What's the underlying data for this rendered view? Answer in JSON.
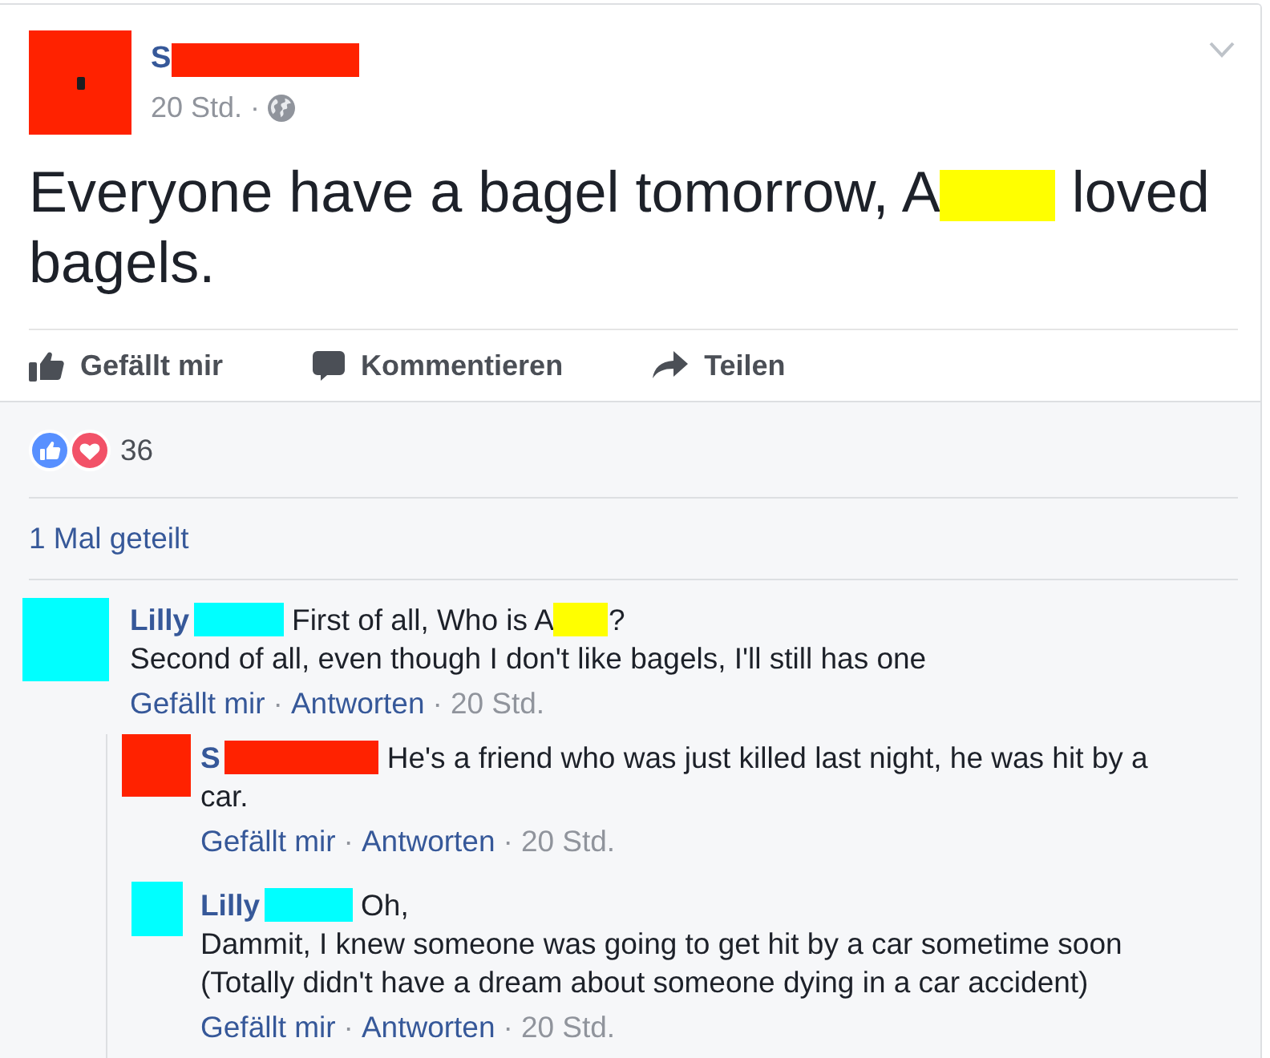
{
  "post": {
    "author": {
      "name": "S",
      "color": "#ff2200"
    },
    "meta": [
      {
        "kind": "time",
        "text": "20 Std."
      },
      {
        "kind": "separator",
        "text": "·"
      }
    ],
    "text": [
      {
        "kind": "text",
        "text": "Everyone have a bagel tomorrow, A"
      },
      {
        "kind": "redaction",
        "color": "#ffff00"
      },
      {
        "kind": "text",
        "text": " loved bagels."
      }
    ]
  },
  "actions": [
    {
      "kind": "like",
      "label": "Gefällt mir"
    },
    {
      "kind": "comment",
      "label": "Kommentieren"
    },
    {
      "kind": "share",
      "label": "Teilen"
    }
  ],
  "reactions": {
    "count": "36"
  },
  "shares": "1 Mal geteilt",
  "comments": [
    {
      "author": "Lilly",
      "color": "#00ffff",
      "body": [
        {
          "kind": "text",
          "text": "First of all, Who is A"
        },
        {
          "kind": "redaction",
          "color": "#ffff00"
        },
        {
          "kind": "text",
          "text": "?\nSecond of all, even though I don't like bagels, I'll still has one"
        }
      ],
      "footer": [
        {
          "kind": "like",
          "text": "Gefällt mir"
        },
        {
          "kind": "separator",
          "text": "·"
        },
        {
          "kind": "reply",
          "text": "Antworten"
        },
        {
          "kind": "separator",
          "text": "·"
        },
        {
          "kind": "time",
          "text": "20 Std."
        }
      ],
      "children": [
        {
          "author": "S",
          "color": "#ff2200",
          "body": [
            {
              "kind": "text",
              "text": "He's a friend who was just killed last night, he was hit by a\ncar."
            }
          ],
          "footer": [
            {
              "kind": "like",
              "text": "Gefällt mir"
            },
            {
              "kind": "separator",
              "text": "·"
            },
            {
              "kind": "reply",
              "text": "Antworten"
            },
            {
              "kind": "separator",
              "text": "·"
            },
            {
              "kind": "time",
              "text": "20 Std."
            }
          ]
        },
        {
          "author": "Lilly",
          "color": "#00ffff",
          "body": [
            {
              "kind": "text",
              "text": "Oh,\nDammit, I knew someone was going to get hit by a car sometime soon\n(Totally didn't have a dream about someone dying in a car accident)"
            }
          ],
          "footer": [
            {
              "kind": "like",
              "text": "Gefällt mir"
            },
            {
              "kind": "separator",
              "text": "·"
            },
            {
              "kind": "reply",
              "text": "Antworten"
            },
            {
              "kind": "separator",
              "text": "·"
            },
            {
              "kind": "time",
              "text": "20 Std."
            }
          ]
        }
      ]
    }
  ]
}
